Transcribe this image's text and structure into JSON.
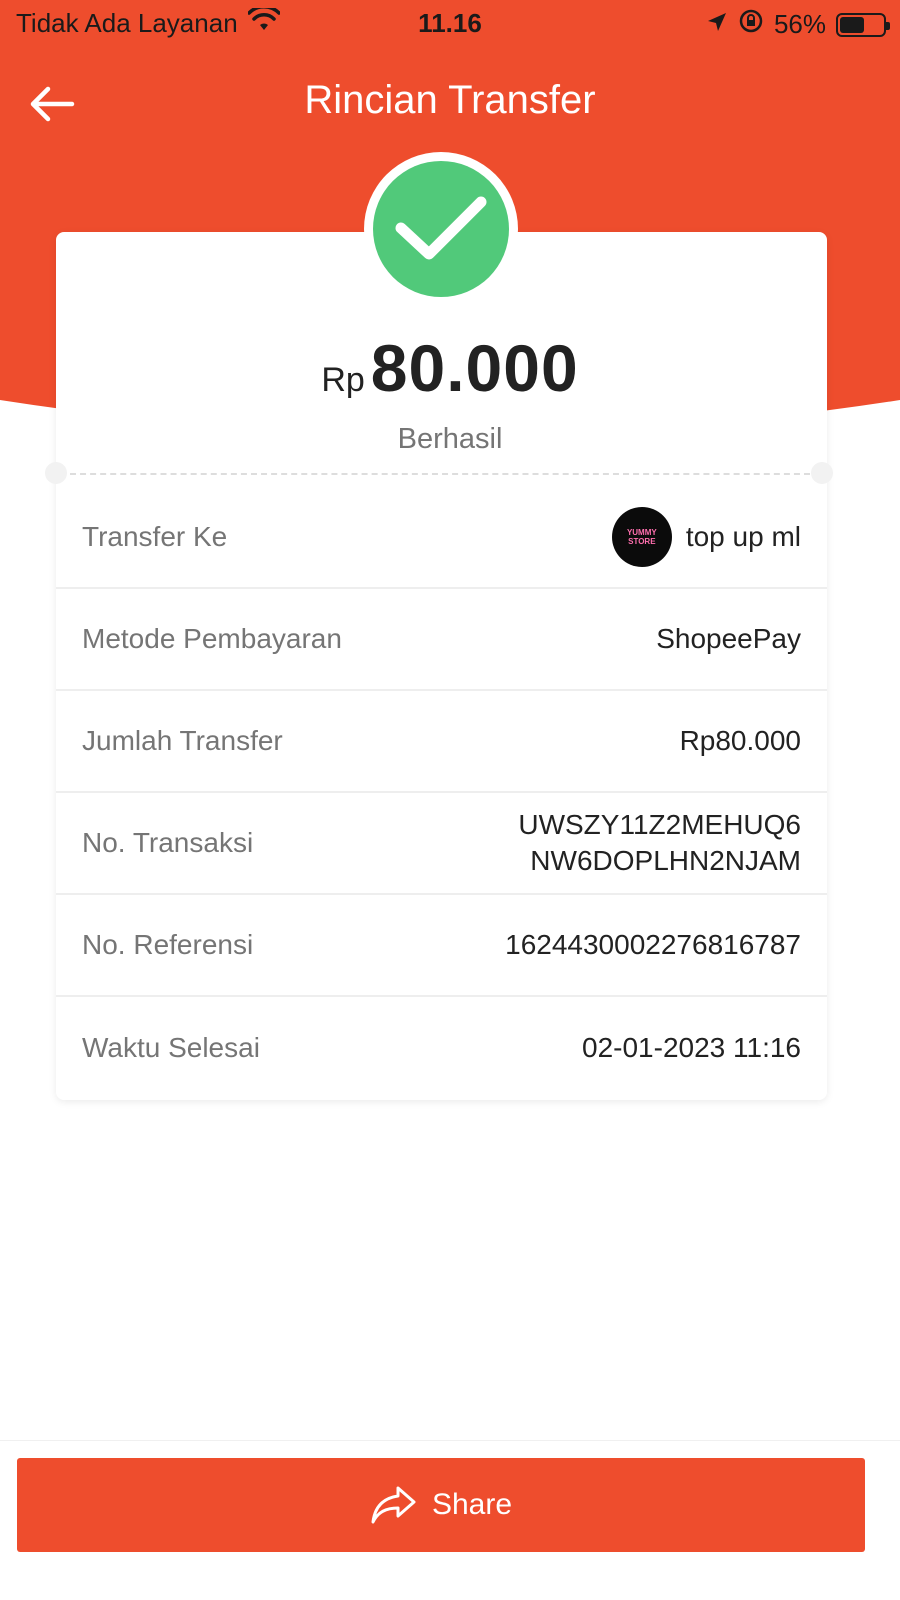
{
  "status_bar": {
    "carrier": "Tidak Ada Layanan",
    "time": "11.16",
    "battery": "56%",
    "battery_level": 0.56
  },
  "nav": {
    "title": "Rincian Transfer"
  },
  "summary": {
    "currency": "Rp",
    "amount": "80.000",
    "status": "Berhasil"
  },
  "details": {
    "transfer_to": {
      "label": "Transfer Ke",
      "value": "top up ml",
      "avatar_text": [
        "YUMMY",
        "STORE"
      ]
    },
    "payment_method": {
      "label": "Metode Pembayaran",
      "value": "ShopeePay"
    },
    "transfer_amount": {
      "label": "Jumlah Transfer",
      "value": "Rp80.000"
    },
    "transaction_no": {
      "label": "No. Transaksi",
      "value_line1": "UWSZY11Z2MEHUQ6",
      "value_line2": "NW6DOPLHN2NJAM"
    },
    "reference_no": {
      "label": "No. Referensi",
      "value": "1624430002276816787"
    },
    "completed_time": {
      "label": "Waktu Selesai",
      "value": "02-01-2023 11:16"
    }
  },
  "actions": {
    "share_label": "Share"
  },
  "colors": {
    "brand": "#ee4d2d",
    "success": "#51c97a"
  }
}
